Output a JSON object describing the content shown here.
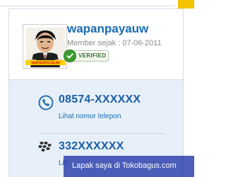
{
  "seller": {
    "name": "wapanpayauw",
    "member_since": "Member sejak : 07-06-2011",
    "verified_label": "VERIFIED",
    "avatar_caption": "WAPANPAYAUW"
  },
  "contact": {
    "phone": "08574-XXXXXX",
    "phone_link": "Lihat nomor telepon",
    "bb_pin": "332XXXXXX",
    "bb_link": "Lih"
  },
  "overlay": {
    "text": "Lapak saya di Tokobagus.com"
  },
  "icons": {
    "phone": "phone-icon",
    "blackberry": "blackberry-icon",
    "verified": "check-icon"
  },
  "colors": {
    "name_link": "#1a6bb0",
    "contact_bg": "#e7f0f8",
    "verified_green": "#3a9b2e",
    "top_accent": "#f5c400",
    "overlay_bg": "#283caa"
  }
}
